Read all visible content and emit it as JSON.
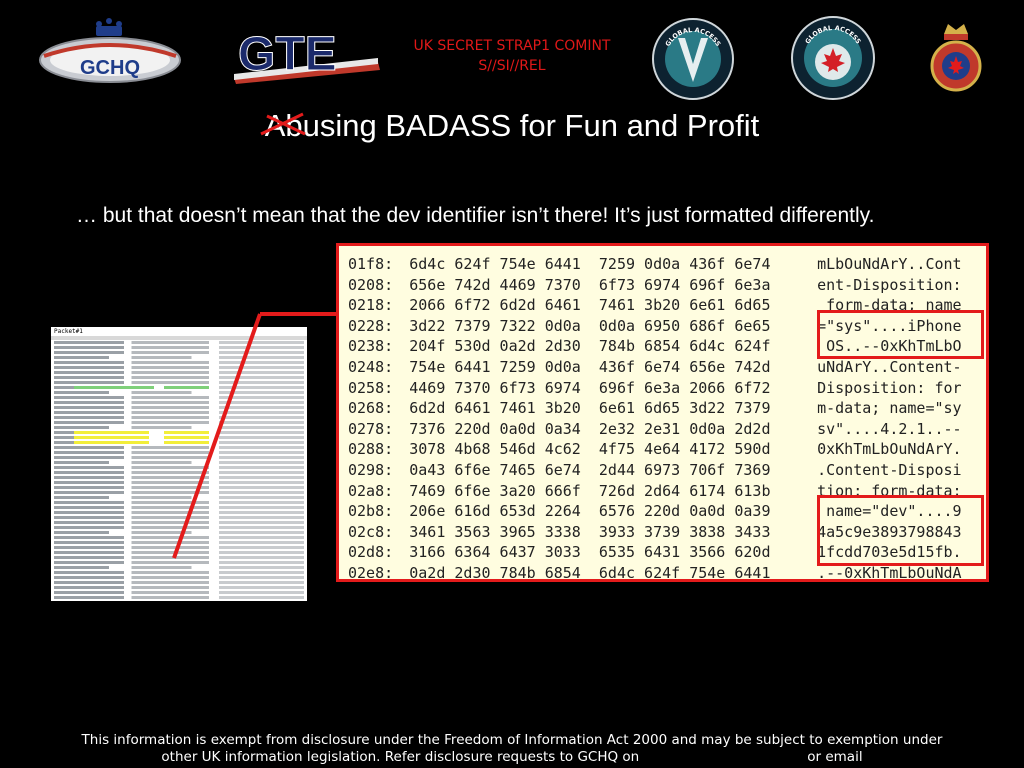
{
  "header": {
    "gchq_text": "GCHQ",
    "gte_text": "GTE",
    "classification_line1": "UK SECRET STRAP1 COMINT",
    "classification_line2": "S//SI//REL",
    "seal1_text": "GLOBAL ACCESS",
    "seal2_text": "GLOBAL ACCESS"
  },
  "title": {
    "struck_prefix": "Ab",
    "rest": "using BADASS for Fun and Profit"
  },
  "body": {
    "text": "… but that doesn’t mean that the dev identifier isn’t there!  It’s just formatted differently."
  },
  "thumbnail": {
    "title": "Packet#1"
  },
  "hex_dump": {
    "rows": [
      {
        "offset": "01f8:",
        "bytes": "6d4c 624f 754e 6441  7259 0d0a 436f 6e74",
        "ascii": "mLbOuNdArY..Cont"
      },
      {
        "offset": "0208:",
        "bytes": "656e 742d 4469 7370  6f73 6974 696f 6e3a",
        "ascii": "ent-Disposition:"
      },
      {
        "offset": "0218:",
        "bytes": "2066 6f72 6d2d 6461  7461 3b20 6e61 6d65",
        "ascii": " form-data; name"
      },
      {
        "offset": "0228:",
        "bytes": "3d22 7379 7322 0d0a  0d0a 6950 686f 6e65",
        "ascii": "=\"sys\"....iPhone"
      },
      {
        "offset": "0238:",
        "bytes": "204f 530d 0a2d 2d30  784b 6854 6d4c 624f",
        "ascii": " OS..--0xKhTmLbO"
      },
      {
        "offset": "0248:",
        "bytes": "754e 6441 7259 0d0a  436f 6e74 656e 742d",
        "ascii": "uNdArY..Content-"
      },
      {
        "offset": "0258:",
        "bytes": "4469 7370 6f73 6974  696f 6e3a 2066 6f72",
        "ascii": "Disposition: for"
      },
      {
        "offset": "0268:",
        "bytes": "6d2d 6461 7461 3b20  6e61 6d65 3d22 7379",
        "ascii": "m-data; name=\"sy"
      },
      {
        "offset": "0278:",
        "bytes": "7376 220d 0a0d 0a34  2e32 2e31 0d0a 2d2d",
        "ascii": "sv\"....4.2.1..--"
      },
      {
        "offset": "0288:",
        "bytes": "3078 4b68 546d 4c62  4f75 4e64 4172 590d",
        "ascii": "0xKhTmLbOuNdArY."
      },
      {
        "offset": "0298:",
        "bytes": "0a43 6f6e 7465 6e74  2d44 6973 706f 7369",
        "ascii": ".Content-Disposi"
      },
      {
        "offset": "02a8:",
        "bytes": "7469 6f6e 3a20 666f  726d 2d64 6174 613b",
        "ascii": "tion: form-data;"
      },
      {
        "offset": "02b8:",
        "bytes": "206e 616d 653d 2264  6576 220d 0a0d 0a39",
        "ascii": " name=\"dev\"....9"
      },
      {
        "offset": "02c8:",
        "bytes": "3461 3563 3965 3338  3933 3739 3838 3433",
        "ascii": "4a5c9e3893798843"
      },
      {
        "offset": "02d8:",
        "bytes": "3166 6364 6437 3033  6535 6431 3566 620d",
        "ascii": "1fcdd703e5d15fb."
      },
      {
        "offset": "02e8:",
        "bytes": "0a2d 2d30 784b 6854  6d4c 624f 754e 6441",
        "ascii": ".--0xKhTmLbOuNdA"
      }
    ]
  },
  "footer": {
    "line1": "This information is exempt from disclosure under the Freedom of Information Act 2000 and may be subject to exemption under",
    "line2a": "other UK information legislation. Refer disclosure requests to GCHQ on",
    "line2b": "or email"
  },
  "colors": {
    "accent_red": "#e31b1b",
    "classification_red": "#e01818",
    "hex_background": "#fffde0"
  }
}
